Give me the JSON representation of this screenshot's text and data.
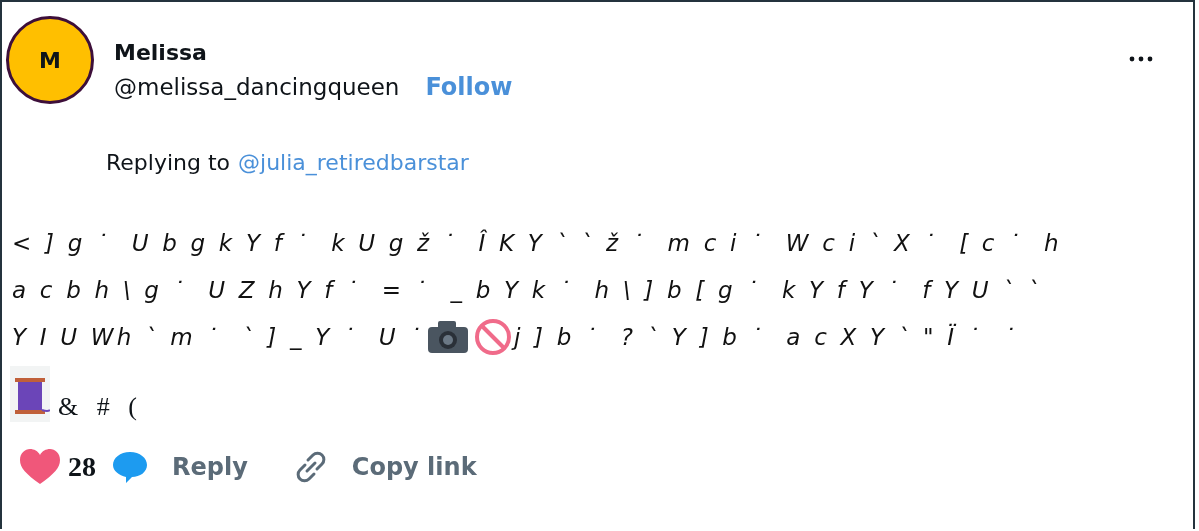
{
  "author": {
    "initial": "M",
    "name": "Melissa",
    "handle": "@melissa_dancingqueen",
    "follow": "Follow"
  },
  "reply_to": {
    "label": "Replying to",
    "handle": "@julia_retiredbarstar"
  },
  "body_lines": [
    "< ] g ˙  U b g k Y f ˙  k U g ž ˙  Î K Y ` ` ž ˙  m c i ˙  W c i ` X ˙  [ c ˙  h",
    "a c b h \\ g ˙  U Z h Y f ˙  = ˙  _ b Y k ˙  h \\ ] b [ g ˙  k Y f Y ˙  f Y U ` `"
  ],
  "body_line_3": {
    "before": "Y I U Wh ` m ˙  ` ] _ Y ˙  U ˙",
    "after": "j ] b ˙  ? ` Y ] b ˙  a c X Y ` \" Ï ˙  ˙"
  },
  "footer_text": "& # (",
  "actions": {
    "likes": "28",
    "reply": "Reply",
    "copy": "Copy link"
  }
}
